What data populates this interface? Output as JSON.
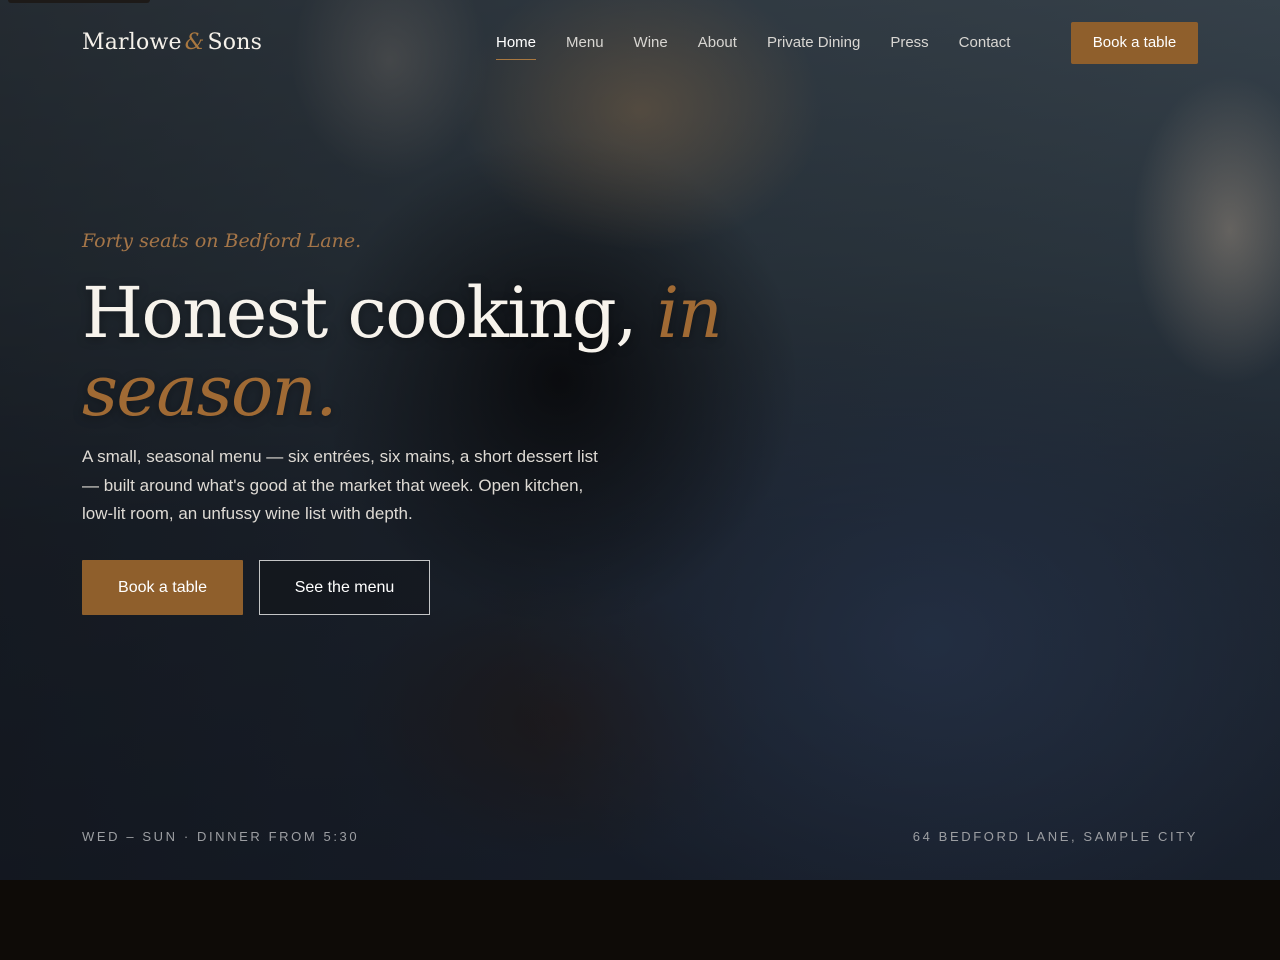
{
  "brand": {
    "name_part1": "Marlowe",
    "ampersand": "&",
    "name_part2": "Sons"
  },
  "nav": {
    "items": [
      {
        "label": "Home",
        "active": true
      },
      {
        "label": "Menu"
      },
      {
        "label": "Wine"
      },
      {
        "label": "About"
      },
      {
        "label": "Private Dining"
      },
      {
        "label": "Press"
      },
      {
        "label": "Contact"
      }
    ],
    "cta_label": "Book a table"
  },
  "hero": {
    "eyebrow": "Forty seats on Bedford Lane.",
    "headline_plain": "Honest cooking,",
    "headline_accent": "in season.",
    "lede": "A small, seasonal menu — six entrées, six mains, a short dessert list — built around what's good at the market that week. Open kitchen, low-lit room, an unfussy wine list with depth.",
    "primary_button": "Book a table",
    "secondary_button": "See the menu"
  },
  "info_bar": {
    "hours": "WED – SUN · DINNER FROM 5:30",
    "address": "64 BEDFORD LANE, SAMPLE CITY"
  },
  "colors": {
    "accent": "#8f5f2c",
    "accent_text": "#a06a34",
    "background_dark": "#0e0b07"
  }
}
